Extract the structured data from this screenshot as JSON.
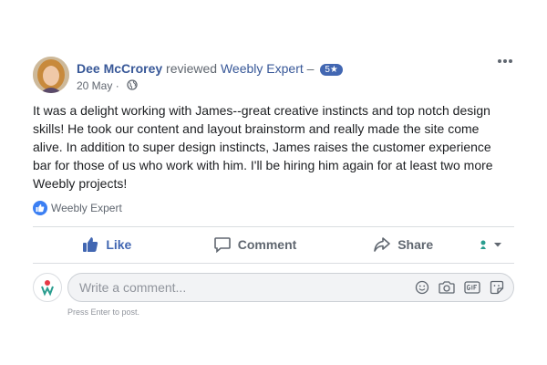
{
  "post": {
    "author": "Dee McCrorey",
    "action_text": "reviewed",
    "page_name": "Weebly Expert",
    "dash": "–",
    "rating": "5★",
    "date": "20 May",
    "dot": "·",
    "body": "It was a delight working with James--great creative instincts and top notch design skills! He took our content and layout brainstorm and really made the site come alive. In addition to super design instincts, James raises the customer experience bar for those of us who work with him. I'll be hiring him again for at least two more Weebly projects!",
    "likes_name": "Weebly Expert"
  },
  "actions": {
    "like": "Like",
    "comment": "Comment",
    "share": "Share"
  },
  "comment_box": {
    "placeholder": "Write a comment...",
    "hint": "Press Enter to post."
  },
  "icons": {
    "more": "more-options-icon",
    "globe": "globe-icon",
    "like_badge": "thumbs-up-icon",
    "emoji": "emoji-icon",
    "camera": "camera-icon",
    "gif": "gif-icon",
    "sticker": "sticker-icon"
  },
  "colors": {
    "brand": "#4267b2",
    "link": "#385898",
    "muted": "#606770"
  }
}
